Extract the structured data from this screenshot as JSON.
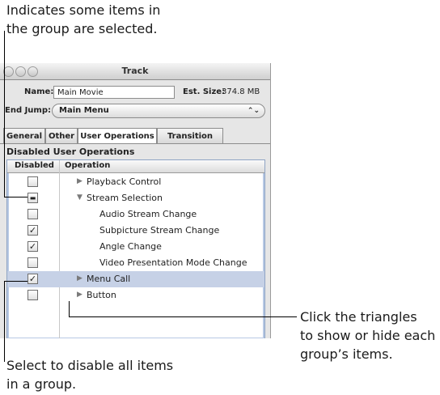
{
  "callouts": {
    "top_line1": "Indicates some items in",
    "top_line2": "the group are selected.",
    "right_line1": "Click the triangles",
    "right_line2": "to show or hide each",
    "right_line3": "group’s items.",
    "bottom_line1": "Select to disable all items",
    "bottom_line2": "in a group."
  },
  "window": {
    "title": "Track",
    "name_label": "Name:",
    "name_value": "Main Movie",
    "size_label": "Est. Size:",
    "size_value": "374.8 MB",
    "end_jump_label": "End Jump:",
    "end_jump_value": "Main Menu",
    "popup_arrows": "⌃⌄"
  },
  "tabs": [
    "General",
    "Other",
    "User Operations",
    "Transition"
  ],
  "section_title": "Disabled User Operations",
  "table": {
    "headers": [
      "Disabled",
      "Operation"
    ],
    "rows": [
      {
        "check": "",
        "triangle": "▶",
        "label": "Playback Control"
      },
      {
        "check": "▬",
        "triangle": "▼",
        "label": "Stream Selection"
      },
      {
        "check": "",
        "triangle": "",
        "label": "Audio Stream Change"
      },
      {
        "check": "✓",
        "triangle": "",
        "label": "Subpicture Stream Change"
      },
      {
        "check": "✓",
        "triangle": "",
        "label": "Angle Change"
      },
      {
        "check": "",
        "triangle": "",
        "label": "Video Presentation Mode Change"
      },
      {
        "check": "✓",
        "triangle": "▶",
        "label": "Menu Call"
      },
      {
        "check": "",
        "triangle": "▶",
        "label": "Button"
      }
    ]
  }
}
